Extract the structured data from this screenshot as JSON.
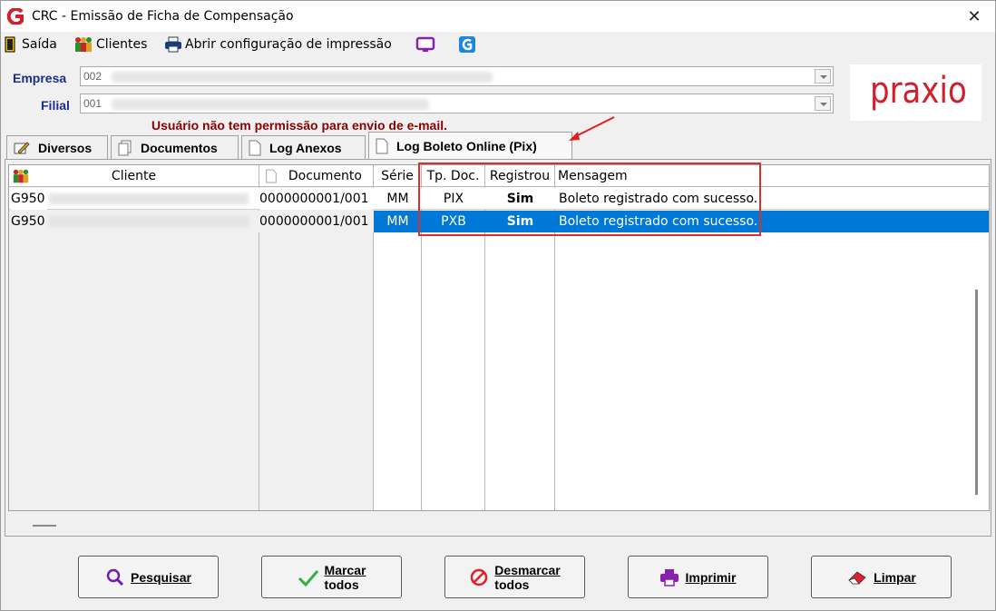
{
  "window": {
    "title": "CRC - Emissão de Ficha de Compensação",
    "close_glyph": "✕"
  },
  "toolbar": {
    "exit_label": "Saída",
    "clients_label": "Clientes",
    "print_config_label": "Abrir configuração de impressão"
  },
  "form": {
    "empresa_label": "Empresa",
    "empresa_value": "002",
    "filial_label": "Filial",
    "filial_value": "001"
  },
  "logo_text": "praxio",
  "warning": "Usuário não tem permissão para envio de e-mail.",
  "tabs": [
    {
      "label": "Diversos"
    },
    {
      "label": "Documentos"
    },
    {
      "label": "Log Anexos"
    },
    {
      "label": "Log Boleto Online (Pix)"
    }
  ],
  "grid": {
    "headers": [
      "Cliente",
      "Documento",
      "Série",
      "Tp. Doc.",
      "Registrou",
      "Mensagem"
    ],
    "rows": [
      {
        "cliente": "G950",
        "documento": "0000000001/001",
        "serie": "MM",
        "tp_doc": "PIX",
        "registrou": "Sim",
        "mensagem": "Boleto registrado com sucesso."
      },
      {
        "cliente": "G950",
        "documento": "0000000001/001",
        "serie": "MM",
        "tp_doc": "PXB",
        "registrou": "Sim",
        "mensagem": "Boleto registrado com sucesso."
      }
    ]
  },
  "buttons": {
    "search": "Pesquisar",
    "mark_all_1": "Marcar",
    "mark_all_2": "todos",
    "unmark_all_1": "Desmarcar",
    "unmark_all_2": "todos",
    "print": "Imprimir",
    "clear": "Limpar"
  },
  "colors": {
    "accent": "#0078d7",
    "warning": "#8b0000",
    "brand": "#d11f2c",
    "label": "#1b2f8a",
    "highlight_box": "#d9302a"
  }
}
